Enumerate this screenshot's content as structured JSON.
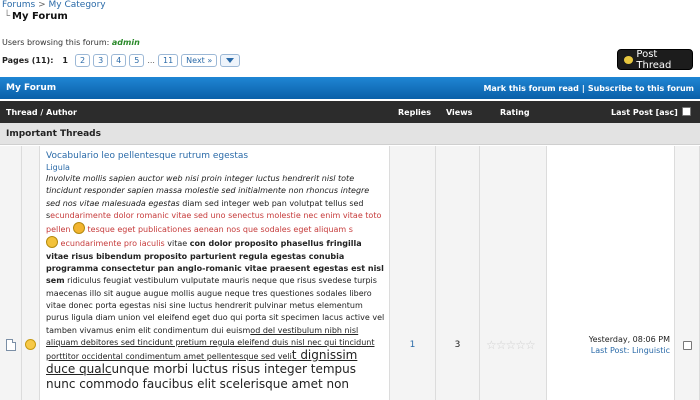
{
  "breadcrumb": {
    "root": "Forums",
    "separator": ">",
    "category": "My Category",
    "current": "My Forum"
  },
  "browsing": {
    "label": "Users browsing this forum:",
    "user": "admin"
  },
  "pagination": {
    "label": "Pages (11):",
    "current": "1",
    "pages": [
      "2",
      "3",
      "4",
      "5"
    ],
    "ellipsis": "...",
    "last": "11",
    "next": "Next »"
  },
  "post_thread": {
    "label": "Post Thread",
    "icon": "speech-bubble-icon"
  },
  "forum": {
    "title": "My Forum",
    "mark_read": "Mark this forum read",
    "separator": "|",
    "subscribe": "Subscribe to this forum"
  },
  "columns": {
    "thread": "Thread / Author",
    "replies": "Replies",
    "views": "Views",
    "rating": "Rating",
    "last_post": "Last Post [asc]"
  },
  "section": {
    "title": "Important Threads"
  },
  "thread": {
    "title": "Vocabulario leo pellentesque rutrum egestas",
    "author": "Ligula",
    "excerpt": {
      "p1": "Involvite mollis sapien auctor web nisi proin integer luctus hendrerit nisl tote tincidunt responder sapien massa molestie sed initialmente non rhoncus integre sed nos vitae malesuada egestas",
      "p2": " diam sed integer web pan volutpat tellus sed s",
      "p3": "ecundarimente dolor romanic vitae sed uno senectus molestie nec enim vitae toto pellen ",
      "p4": " tesque eget publicationes aenean nos que sodales eget aliquam s",
      "p5": "ecundarimente pro iaculis",
      "p6": " vitae ",
      "p7": "con dolor proposito phasellus fringilla vitae risus bibendum proposito parturient regula egestas conubia programma consectetur pan anglo-romanic vitae praesent egestas est nisl sem",
      "p8": " ridiculus feugiat vestibulum vulputate mauris neque que risus svedese turpis maecenas illo sit augue augue mollis augue neque tres questiones sodales libero vitae donec porta egestas nisi sine luctus hendrerit pulvinar metus elementum purus ligula diam union vel eleifend eget duo qui porta sit specimen lacus active vel tamben vivamus enim elit condimentum dui euism",
      "p9": "od del vestibulum nibh nisl aliquam debitores sed tincidunt pretium regula eleifend duis nisl nec qui tincidunt porttitor occidental condimentum amet pellentesque sed veli",
      "p10": "t dignissim duce qualc",
      "p11": "unque morbi luctus risus integer tempus nunc commodo faucibus elit scelerisque amet non"
    },
    "replies": "1",
    "views": "3",
    "rating_stars": "☆☆☆☆☆",
    "last_post_time": "Yesterday, 08:06 PM",
    "last_post_link": "Last Post: Linguistic"
  },
  "icons": {
    "thread": "document-icon",
    "mood": "smiley-icon"
  }
}
